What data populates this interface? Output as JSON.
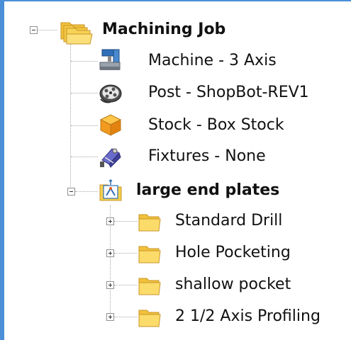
{
  "tree": {
    "root": {
      "label": "Machining Job",
      "icon": "folder-stack-icon"
    },
    "setup_items": [
      {
        "label": "Machine - 3 Axis",
        "icon": "machine-icon"
      },
      {
        "label": "Post - ShopBot-REV1",
        "icon": "post-reel-icon"
      },
      {
        "label": "Stock - Box Stock",
        "icon": "stock-box-icon"
      },
      {
        "label": "Fixtures - None",
        "icon": "fixtures-clamp-icon"
      }
    ],
    "part": {
      "label": "large end plates",
      "icon": "part-setup-icon"
    },
    "operations": [
      {
        "label": "Standard Drill",
        "icon": "folder-icon"
      },
      {
        "label": "Hole Pocketing",
        "icon": "folder-icon"
      },
      {
        "label": "shallow pocket",
        "icon": "folder-icon"
      },
      {
        "label": "2 1/2 Axis Profiling",
        "icon": "folder-icon"
      }
    ]
  },
  "colors": {
    "folder": "#f6cf4a",
    "selection_border": "#4a8fd8"
  }
}
